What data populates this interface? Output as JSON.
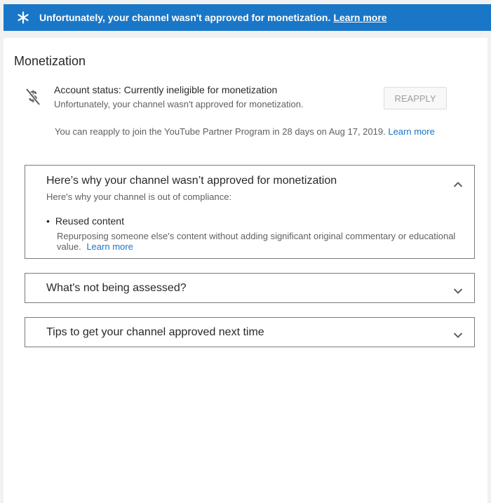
{
  "banner": {
    "icon": "asterisk-icon",
    "message": "Unfortunately, your channel wasn't approved for monetization.",
    "link": "Learn more"
  },
  "page": {
    "title": "Monetization"
  },
  "status": {
    "icon": "dollar-off-icon",
    "title": "Account status: Currently ineligible for monetization",
    "subtitle": "Unfortunately, your channel wasn't approved for monetization.",
    "button": "REAPPLY",
    "note": "You can reapply to join the YouTube Partner Program in 28 days on Aug 17, 2019.",
    "note_link": "Learn more"
  },
  "panels": [
    {
      "title": "Here’s why your channel wasn’t approved for monetization",
      "subtitle": "Here's why your channel is out of compliance:",
      "expanded": true,
      "item": "Reused content",
      "item_desc": "Repurposing someone else's content without adding significant original commentary or educational value.",
      "item_link": "Learn more"
    },
    {
      "title": "What's not being assessed?",
      "expanded": false
    },
    {
      "title": "Tips to get your channel approved next time",
      "expanded": false
    }
  ],
  "colors": {
    "banner": "#1a77c8",
    "link": "#1a73c8"
  }
}
